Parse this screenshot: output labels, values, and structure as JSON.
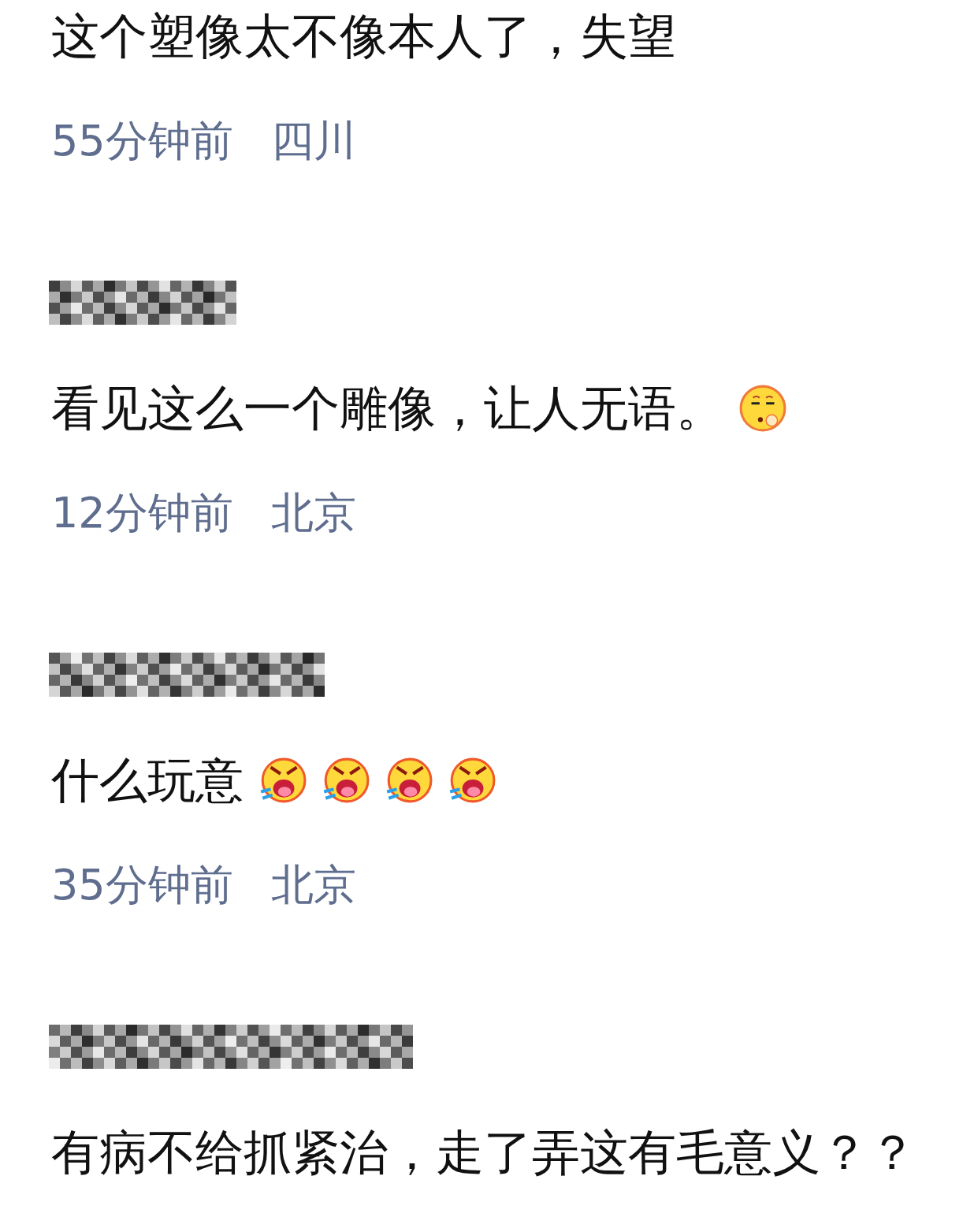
{
  "comments": [
    {
      "text": "这个塑像太不像本人了，失望",
      "time": "55分钟前",
      "location": "四川"
    },
    {
      "author_blurred": true,
      "text": "看见这么一个雕像，让人无语。",
      "emojis": [
        {
          "kind": "sleepy"
        }
      ],
      "time": "12分钟前",
      "location": "北京"
    },
    {
      "author_blurred": true,
      "text": "什么玩意",
      "emojis": [
        {
          "kind": "angry"
        },
        {
          "kind": "angry"
        },
        {
          "kind": "angry"
        },
        {
          "kind": "angry"
        }
      ],
      "time": "35分钟前",
      "location": "北京"
    },
    {
      "author_blurred": true,
      "text": "有病不给抓紧治，走了弄这有毛意义？？"
    }
  ]
}
